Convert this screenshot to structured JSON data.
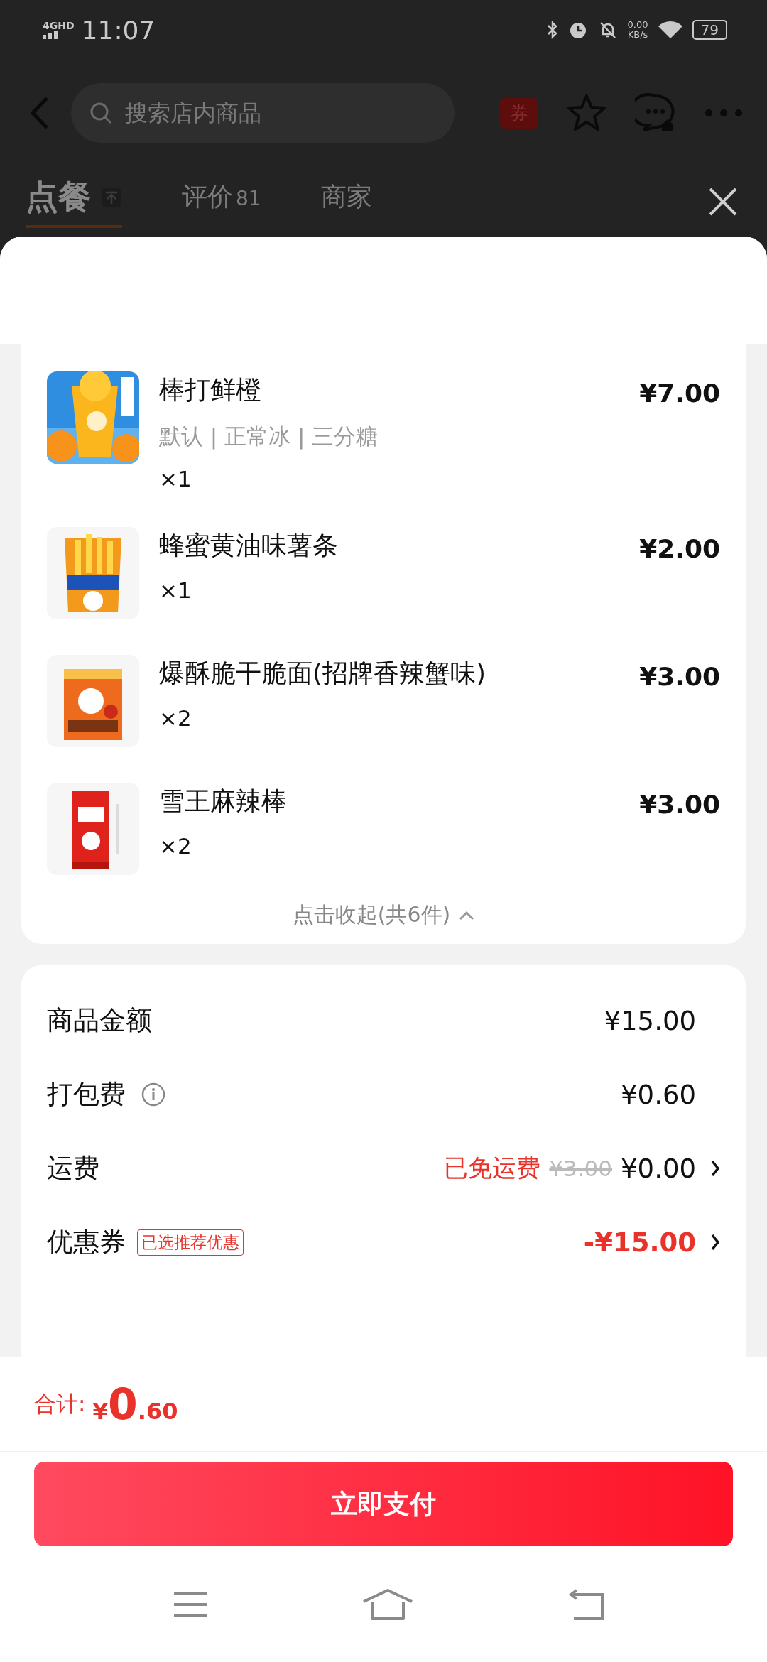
{
  "status_bar": {
    "network": "4GHD",
    "time": "11:07",
    "speed": "0.00",
    "speed_unit": "KB/s",
    "battery": "79"
  },
  "header": {
    "search": {
      "placeholder": "搜索店内商品"
    },
    "coupon_badge": "券"
  },
  "tabs": [
    {
      "label": "点餐",
      "selected": true
    },
    {
      "label": "评价",
      "count": "81",
      "selected": false
    },
    {
      "label": "商家",
      "selected": false
    }
  ],
  "cart": {
    "items": [
      {
        "name": "棒打鲜橙",
        "options": "默认 | 正常冰 | 三分糖",
        "quantity": "×1",
        "price": "¥7.00"
      },
      {
        "name": "蜂蜜黄油味薯条",
        "quantity": "×1",
        "price": "¥2.00"
      },
      {
        "name": "爆酥脆干脆面(招牌香辣蟹味)",
        "quantity": "×2",
        "price": "¥3.00"
      },
      {
        "name": "雪王麻辣棒",
        "quantity": "×2",
        "price": "¥3.00"
      }
    ],
    "collapse": "点击收起(共6件)"
  },
  "summary": {
    "rows": [
      {
        "kind": "plain",
        "label": "商品金额",
        "value": "¥15.00"
      },
      {
        "kind": "info",
        "label": "打包费",
        "value": "¥0.60"
      },
      {
        "kind": "shipping",
        "label": "运费",
        "note": "已免运费",
        "original": "¥3.00",
        "value": "¥0.00"
      },
      {
        "kind": "coupon",
        "label": "优惠券",
        "tag": "已选推荐优惠",
        "value": "-¥15.00"
      }
    ]
  },
  "footer": {
    "total_label": "合计:",
    "currency": "¥",
    "total_int": "0",
    "total_dec": ".60",
    "pay_button": "立即支付"
  }
}
